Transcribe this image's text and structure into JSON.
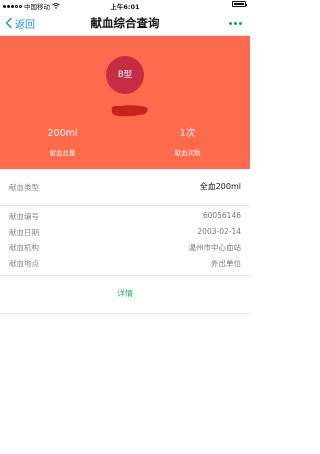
{
  "status_bar": {
    "carrier": "中国移动",
    "time": "上午6:01",
    "signal_icon": "signal-dots-icon",
    "wifi_icon": "wifi-icon",
    "battery_icon": "battery-icon"
  },
  "nav": {
    "back_label": "返回",
    "title": "献血综合查询",
    "back_icon": "chevron-left-icon",
    "more_icon": "more-dots-icon",
    "accent_color": "#1a8ee6"
  },
  "hero": {
    "background_color": "#ff6a4d",
    "blood_type": "B型",
    "blood_type_circle_color": "#c42d43",
    "stats": [
      {
        "value": "200ml",
        "label": "献血总量"
      },
      {
        "value": "1次",
        "label": "献血次数"
      }
    ]
  },
  "blood_type_row": {
    "label": "献血类型",
    "value": "全血200ml"
  },
  "details": [
    {
      "label": "献血编号",
      "value": "60056146"
    },
    {
      "label": "献血日期",
      "value": "2003-02-14"
    },
    {
      "label": "献血机构",
      "value": "温州市中心血站"
    },
    {
      "label": "献血地点",
      "value": "外出单位"
    }
  ],
  "details_link": {
    "label": "详情",
    "color": "#2bb55a"
  }
}
